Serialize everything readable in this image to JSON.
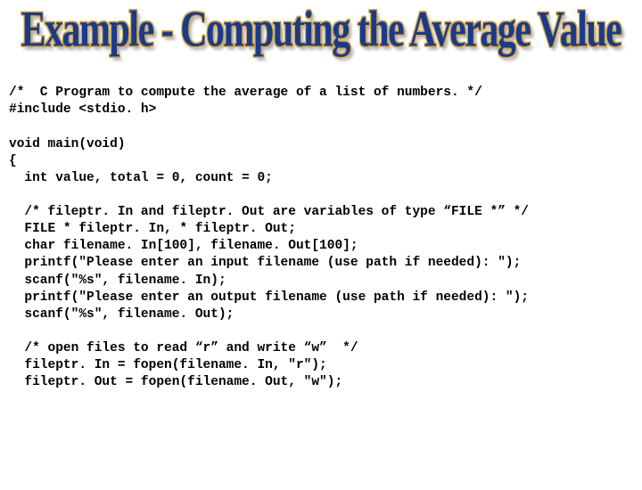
{
  "heading": "Example - Computing the Average Value",
  "code": {
    "l01": "/*  C Program to compute the average of a list of numbers. */",
    "l02": "#include <stdio. h>",
    "l03": "",
    "l04": "void main(void)",
    "l05": "{",
    "l06": "  int value, total = 0, count = 0;",
    "l07": "",
    "l08": "  /* fileptr. In and fileptr. Out are variables of type “FILE *” */",
    "l09": "  FILE * fileptr. In, * fileptr. Out;",
    "l10": "  char filename. In[100], filename. Out[100];",
    "l11": "  printf(\"Please enter an input filename (use path if needed): \");",
    "l12": "  scanf(\"%s\", filename. In);",
    "l13": "  printf(\"Please enter an output filename (use path if needed): \");",
    "l14": "  scanf(\"%s\", filename. Out);",
    "l15": "",
    "l16": "  /* open files to read “r” and write “w”  */",
    "l17": "  fileptr. In = fopen(filename. In, \"r\");",
    "l18": "  fileptr. Out = fopen(filename. Out, \"w\");"
  }
}
